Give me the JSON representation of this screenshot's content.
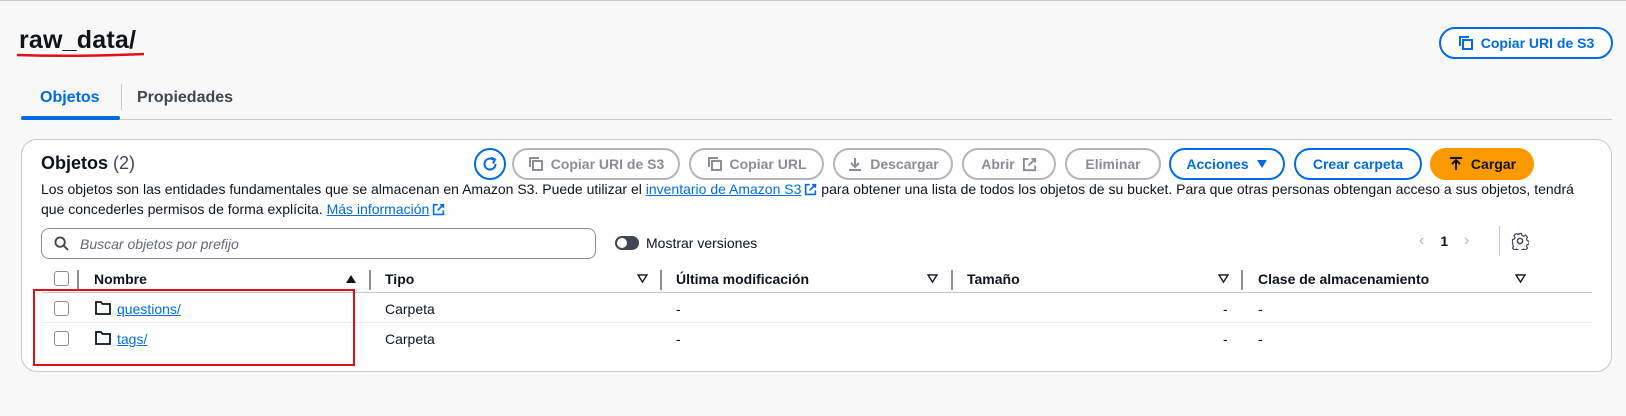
{
  "header": {
    "title": "raw_data/",
    "copy_uri_label": "Copiar URI de S3"
  },
  "tabs": [
    {
      "label": "Objetos",
      "active": true
    },
    {
      "label": "Propiedades",
      "active": false
    }
  ],
  "objects_panel": {
    "title": "Objetos",
    "count": "(2)",
    "toolbar": {
      "refresh_icon": "refresh-icon",
      "copy_uri_label": "Copiar URI de S3",
      "copy_url_label": "Copiar URL",
      "download_label": "Descargar",
      "open_label": "Abrir",
      "delete_label": "Eliminar",
      "actions_label": "Acciones",
      "create_folder_label": "Crear carpeta",
      "upload_label": "Cargar"
    },
    "description": {
      "part1": "Los objetos son las entidades fundamentales que se almacenan en Amazon S3. Puede utilizar el ",
      "inventory_link": "inventario de Amazon S3",
      "part2": " para obtener una lista de todos los objetos de su bucket. Para que otras personas obtengan acceso a sus objetos, tendrá que concederles permisos de forma explícita. ",
      "more_info_link": "Más información"
    },
    "search": {
      "placeholder": "Buscar objetos por prefijo",
      "value": ""
    },
    "show_versions": {
      "label": "Mostrar versiones",
      "enabled": false
    },
    "pagination": {
      "current_page": "1"
    },
    "table": {
      "columns": [
        "Nombre",
        "Tipo",
        "Última modificación",
        "Tamaño",
        "Clase de almacenamiento"
      ],
      "rows": [
        {
          "name": "questions/",
          "type": "Carpeta",
          "last_modified": "-",
          "size": "-",
          "storage_class": "-"
        },
        {
          "name": "tags/",
          "type": "Carpeta",
          "last_modified": "-",
          "size": "-",
          "storage_class": "-"
        }
      ]
    }
  },
  "colors": {
    "accent": "#006ce0",
    "upload_button": "#ff9900",
    "annotation_red": "#e0101a"
  }
}
